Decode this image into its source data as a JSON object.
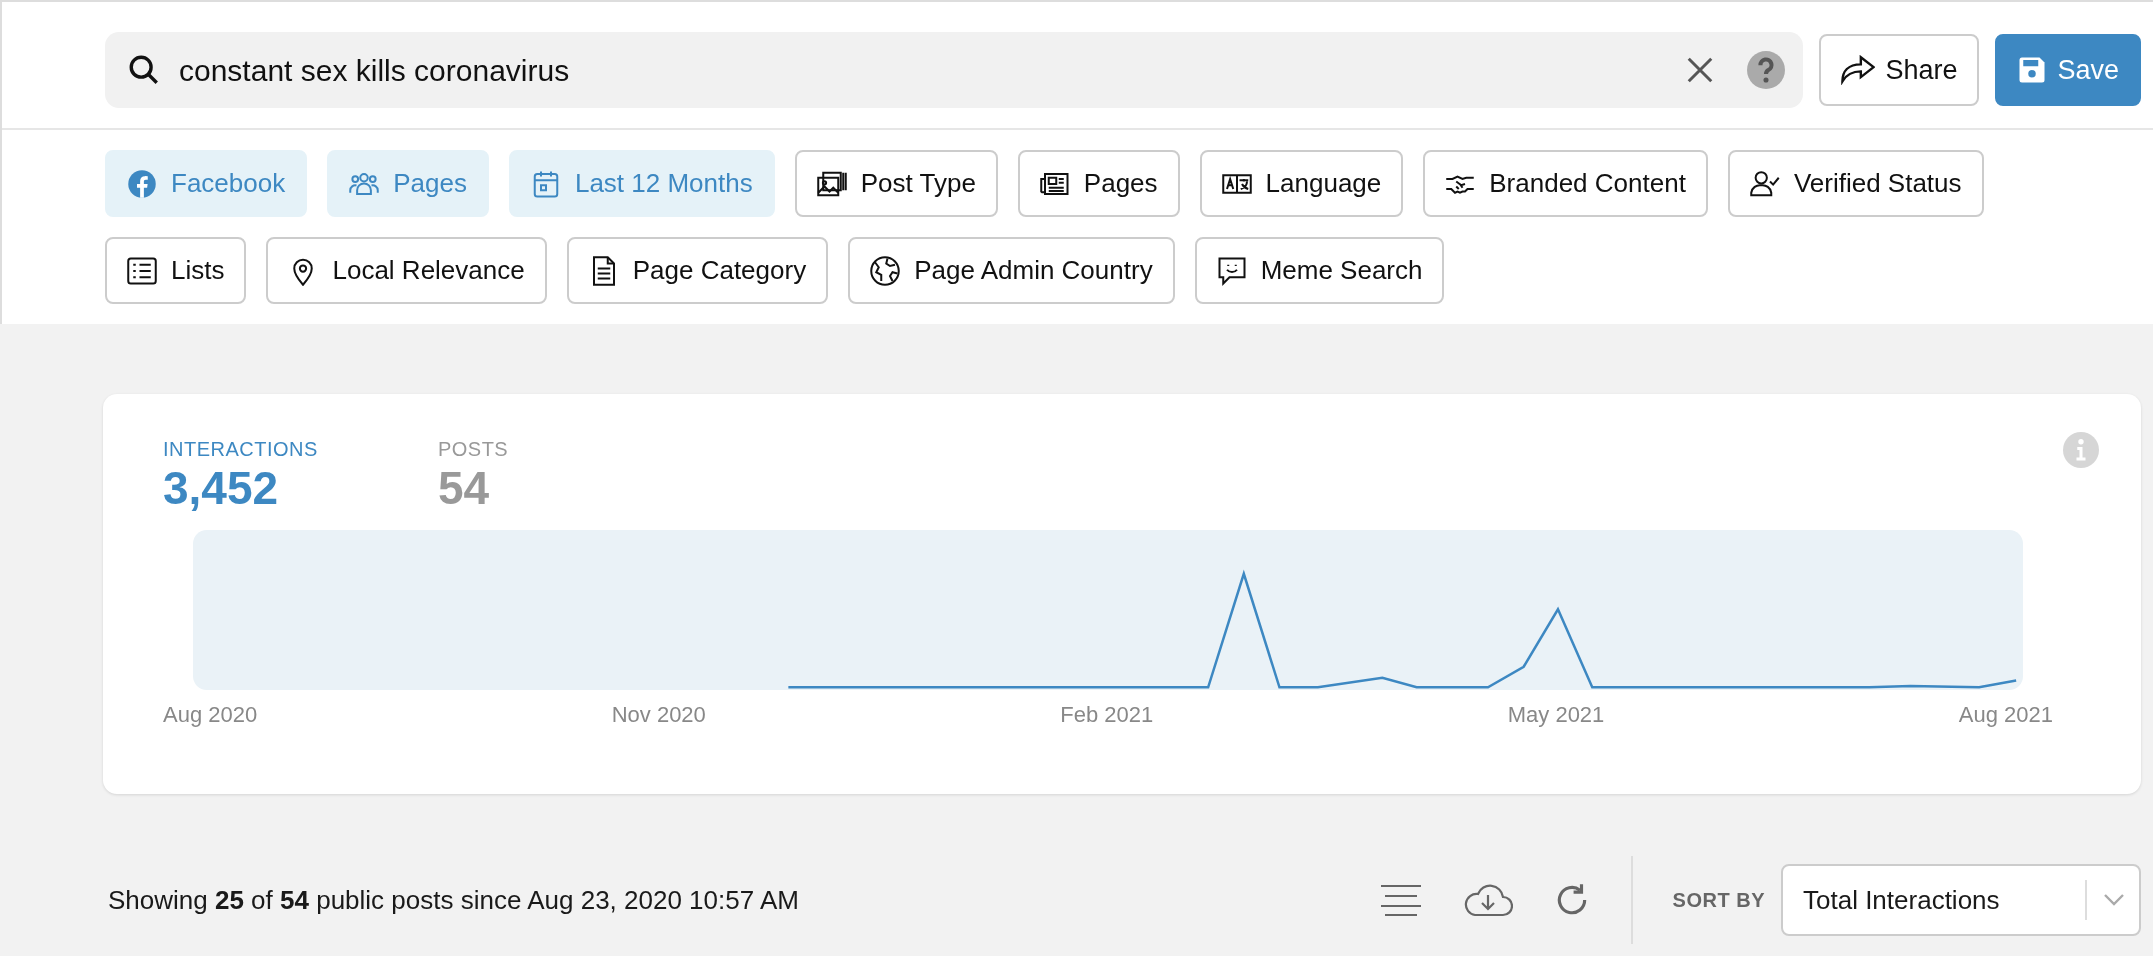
{
  "search": {
    "value": "constant sex kills coronavirus"
  },
  "header_buttons": [
    {
      "label": "Share",
      "kind": "share"
    },
    {
      "label": "Save",
      "kind": "save"
    }
  ],
  "filters": [
    {
      "label": "Facebook",
      "selected": true
    },
    {
      "label": "Pages",
      "selected": true
    },
    {
      "label": "Last 12 Months",
      "selected": true
    },
    {
      "label": "Post Type",
      "selected": false
    },
    {
      "label": "Pages",
      "selected": false
    },
    {
      "label": "Language",
      "selected": false
    },
    {
      "label": "Branded Content",
      "selected": false
    },
    {
      "label": "Verified Status",
      "selected": false
    },
    {
      "label": "Lists",
      "selected": false
    },
    {
      "label": "Local Relevance",
      "selected": false
    },
    {
      "label": "Page Category",
      "selected": false
    },
    {
      "label": "Page Admin Country",
      "selected": false
    },
    {
      "label": "Meme Search",
      "selected": false
    }
  ],
  "stats": [
    {
      "label": "INTERACTIONS",
      "value": "3,452",
      "selected": true
    },
    {
      "label": "POSTS",
      "value": "54",
      "selected": false
    }
  ],
  "chart": {
    "x_labels": [
      "Aug 2020",
      "Nov 2020",
      "Feb 2021",
      "May 2021",
      "Aug 2021"
    ]
  },
  "results": {
    "summary": "Showing **25** of **54** public posts since Aug 23, 2020 10:57 AM",
    "sort_label": "SORT BY",
    "sort_value": "Total Interactions"
  }
}
